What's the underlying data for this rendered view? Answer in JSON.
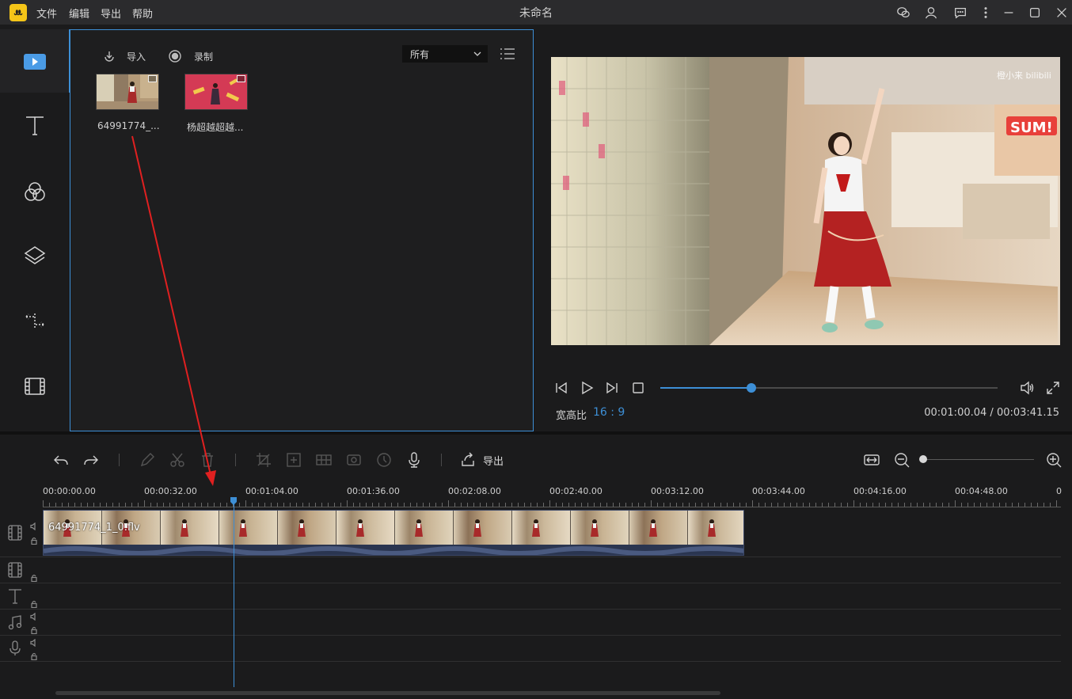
{
  "app": {
    "title": "未命名",
    "logo_text": "ꔚ",
    "menu": [
      "文件",
      "编辑",
      "导出",
      "帮助"
    ],
    "titlebar_icons": [
      "wechat-icon",
      "user-icon",
      "feedback-icon",
      "more-icon",
      "minimize-icon",
      "maximize-icon",
      "close-icon"
    ]
  },
  "sidebar": {
    "items": [
      {
        "icon": "media-icon",
        "selected": true
      },
      {
        "icon": "text-icon"
      },
      {
        "icon": "filter-icon"
      },
      {
        "icon": "overlay-icon"
      },
      {
        "icon": "transition-icon"
      },
      {
        "icon": "element-icon"
      }
    ]
  },
  "media": {
    "import_label": "导入",
    "record_label": "录制",
    "filter_value": "所有",
    "items": [
      {
        "name": "64991774_...",
        "thumb": "dance-mall"
      },
      {
        "name": "杨超越超越...",
        "thumb": "red-stage"
      }
    ]
  },
  "preview": {
    "watermark": "橙小来 bilibili",
    "sign_text": "SUM!",
    "aspect_label": "宽高比",
    "aspect_value": "16 : 9",
    "current_time": "00:01:00.04",
    "total_time": "00:03:41.15",
    "time_separator": " / ",
    "progress": 0.27
  },
  "toolbar": {
    "export_label": "导出",
    "zoom_level": 0
  },
  "timeline": {
    "ruler_labels": [
      "00:00:00.00",
      "00:00:32.00",
      "00:01:04.00",
      "00:01:36.00",
      "00:02:08.00",
      "00:02:40.00",
      "00:03:12.00",
      "00:03:44.00",
      "00:04:16.00",
      "00:04:48.00",
      "0"
    ],
    "clip_name": "64991774_1_0.flv",
    "tracks": [
      "video-track",
      "pip-track",
      "text-track",
      "music-track",
      "voice-track"
    ]
  },
  "colors": {
    "accent": "#3d8fd6",
    "logo": "#f5c518",
    "arrow": "#e02020"
  }
}
